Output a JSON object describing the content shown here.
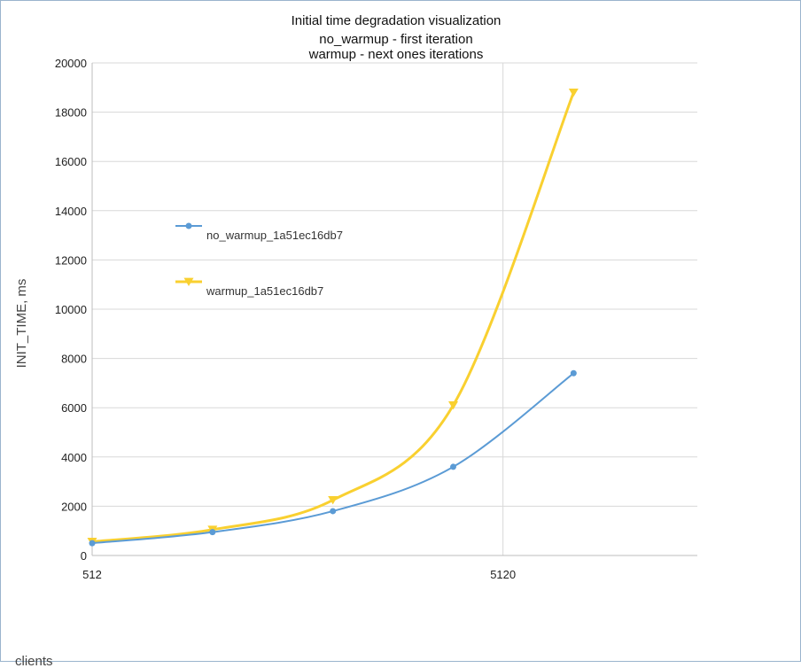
{
  "chart_data": {
    "type": "line",
    "title_lines": [
      "Initial time degradation visualization",
      "no_warmup - first iteration",
      "warmup - next ones iterations"
    ],
    "xlabel": "clients",
    "ylabel": "INIT_TIME, ms",
    "x_ticks": [
      512,
      5120
    ],
    "y_ticks": [
      0,
      2000,
      4000,
      6000,
      8000,
      10000,
      12000,
      14000,
      16000,
      18000,
      20000
    ],
    "xlim": [
      512,
      7300
    ],
    "ylim": [
      0,
      20000
    ],
    "grid": true,
    "legend_position": "upper-left inside plot",
    "series": [
      {
        "name": "no_warmup_1a51ec16db7",
        "color": "#5b9bd5",
        "marker": "circle",
        "x": [
          512,
          1862,
          3212,
          4562,
          5912
        ],
        "y": [
          500,
          950,
          1800,
          3600,
          7400
        ]
      },
      {
        "name": "warmup_1a51ec16db7",
        "color": "#f9d030",
        "marker": "triangle-down",
        "x": [
          512,
          1862,
          3212,
          4562,
          5912
        ],
        "y": [
          560,
          1050,
          2250,
          6100,
          18800
        ]
      }
    ]
  }
}
